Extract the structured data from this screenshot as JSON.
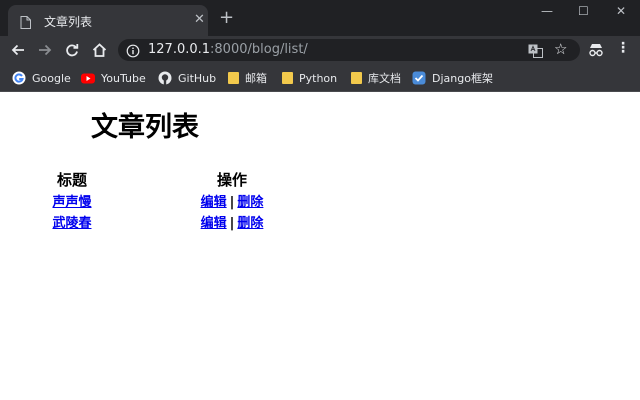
{
  "browser": {
    "tab": {
      "title": "文章列表",
      "close_glyph": "✕"
    },
    "new_tab_glyph": "+",
    "window_controls": {
      "minimize": "—",
      "maximize": "☐",
      "close": "✕"
    },
    "address": {
      "host": "127.0.0.1",
      "rest": ":8000/blog/list/"
    },
    "bookmarks": [
      {
        "label": "Google",
        "icon": "google-icon"
      },
      {
        "label": "YouTube",
        "icon": "youtube-icon"
      },
      {
        "label": "GitHub",
        "icon": "github-icon"
      },
      {
        "label": "邮箱",
        "icon": "folder-icon"
      },
      {
        "label": "Python",
        "icon": "folder-icon"
      },
      {
        "label": "库文档",
        "icon": "folder-icon"
      },
      {
        "label": "Django框架",
        "icon": "django-icon"
      }
    ],
    "colors": {
      "frame": "#202124",
      "toolbar": "#35363a",
      "text": "#e8eaed",
      "link": "#0000ee"
    }
  },
  "page": {
    "title": "文章列表",
    "table": {
      "headers": [
        "标题",
        "操作"
      ],
      "rows": [
        {
          "title": "声声慢",
          "edit": "编辑",
          "delete": "删除"
        },
        {
          "title": "武陵春",
          "edit": "编辑",
          "delete": "删除"
        }
      ],
      "separator": "|"
    }
  }
}
